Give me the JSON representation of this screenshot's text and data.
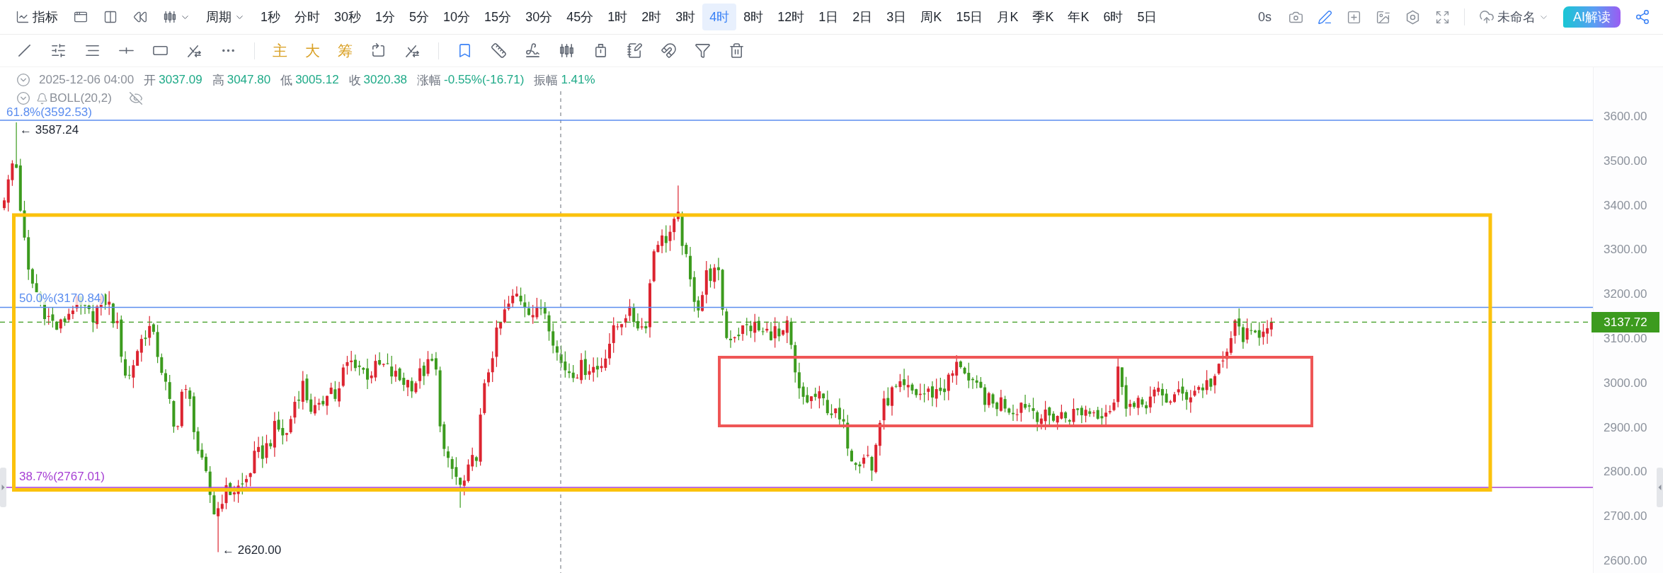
{
  "top_toolbar": {
    "indicator_button": "指标",
    "period_button": "周期",
    "intervals": [
      {
        "label": "1秒",
        "selected": false
      },
      {
        "label": "分时",
        "selected": false
      },
      {
        "label": "30秒",
        "selected": false
      },
      {
        "label": "1分",
        "selected": false
      },
      {
        "label": "5分",
        "selected": false
      },
      {
        "label": "10分",
        "selected": false
      },
      {
        "label": "15分",
        "selected": false
      },
      {
        "label": "30分",
        "selected": false
      },
      {
        "label": "45分",
        "selected": false
      },
      {
        "label": "1时",
        "selected": false
      },
      {
        "label": "2时",
        "selected": false
      },
      {
        "label": "3时",
        "selected": false
      },
      {
        "label": "4时",
        "selected": true
      },
      {
        "label": "8时",
        "selected": false
      },
      {
        "label": "12时",
        "selected": false
      },
      {
        "label": "1日",
        "selected": false
      },
      {
        "label": "2日",
        "selected": false
      },
      {
        "label": "3日",
        "selected": false
      },
      {
        "label": "周K",
        "selected": false
      },
      {
        "label": "15日",
        "selected": false
      },
      {
        "label": "月K",
        "selected": false
      },
      {
        "label": "季K",
        "selected": false
      },
      {
        "label": "年K",
        "selected": false
      },
      {
        "label": "6时",
        "selected": false
      },
      {
        "label": "5日",
        "selected": false
      }
    ],
    "timer": "0s",
    "draw_mode_active": true,
    "layout_name": "未命名",
    "ai_button": "AI解读"
  },
  "drawing_toolbar": {
    "text_tools": [
      "主",
      "大",
      "筹"
    ],
    "pin_active": true
  },
  "legend": {
    "date": "2025-12-06 04:00",
    "fields": [
      {
        "label": "开",
        "value": "3037.09"
      },
      {
        "label": "高",
        "value": "3047.80"
      },
      {
        "label": "低",
        "value": "3005.12"
      },
      {
        "label": "收",
        "value": "3020.38"
      },
      {
        "label": "涨幅",
        "value": "-0.55%(-16.71)"
      },
      {
        "label": "振幅",
        "value": "1.41%"
      }
    ],
    "indicator": {
      "name": "BOLL(20,2)",
      "visible": false
    }
  },
  "chart": {
    "fib_levels": [
      {
        "label": "61.8%(3592.53)",
        "color": "#5b8def"
      },
      {
        "label": "50.0%(3170.84)",
        "color": "#5b8def"
      },
      {
        "label": "38.7%(2767.01)",
        "color": "#a63fd4"
      }
    ],
    "high_marker": "← 3587.24",
    "low_marker": "← 2620.00",
    "last_price": "3137.72",
    "price_axis": [
      "3600.00",
      "3500.00",
      "3400.00",
      "3300.00",
      "3200.00",
      "3100.00",
      "3000.00",
      "2900.00",
      "2800.00",
      "2700.00",
      "2600.00"
    ]
  }
}
